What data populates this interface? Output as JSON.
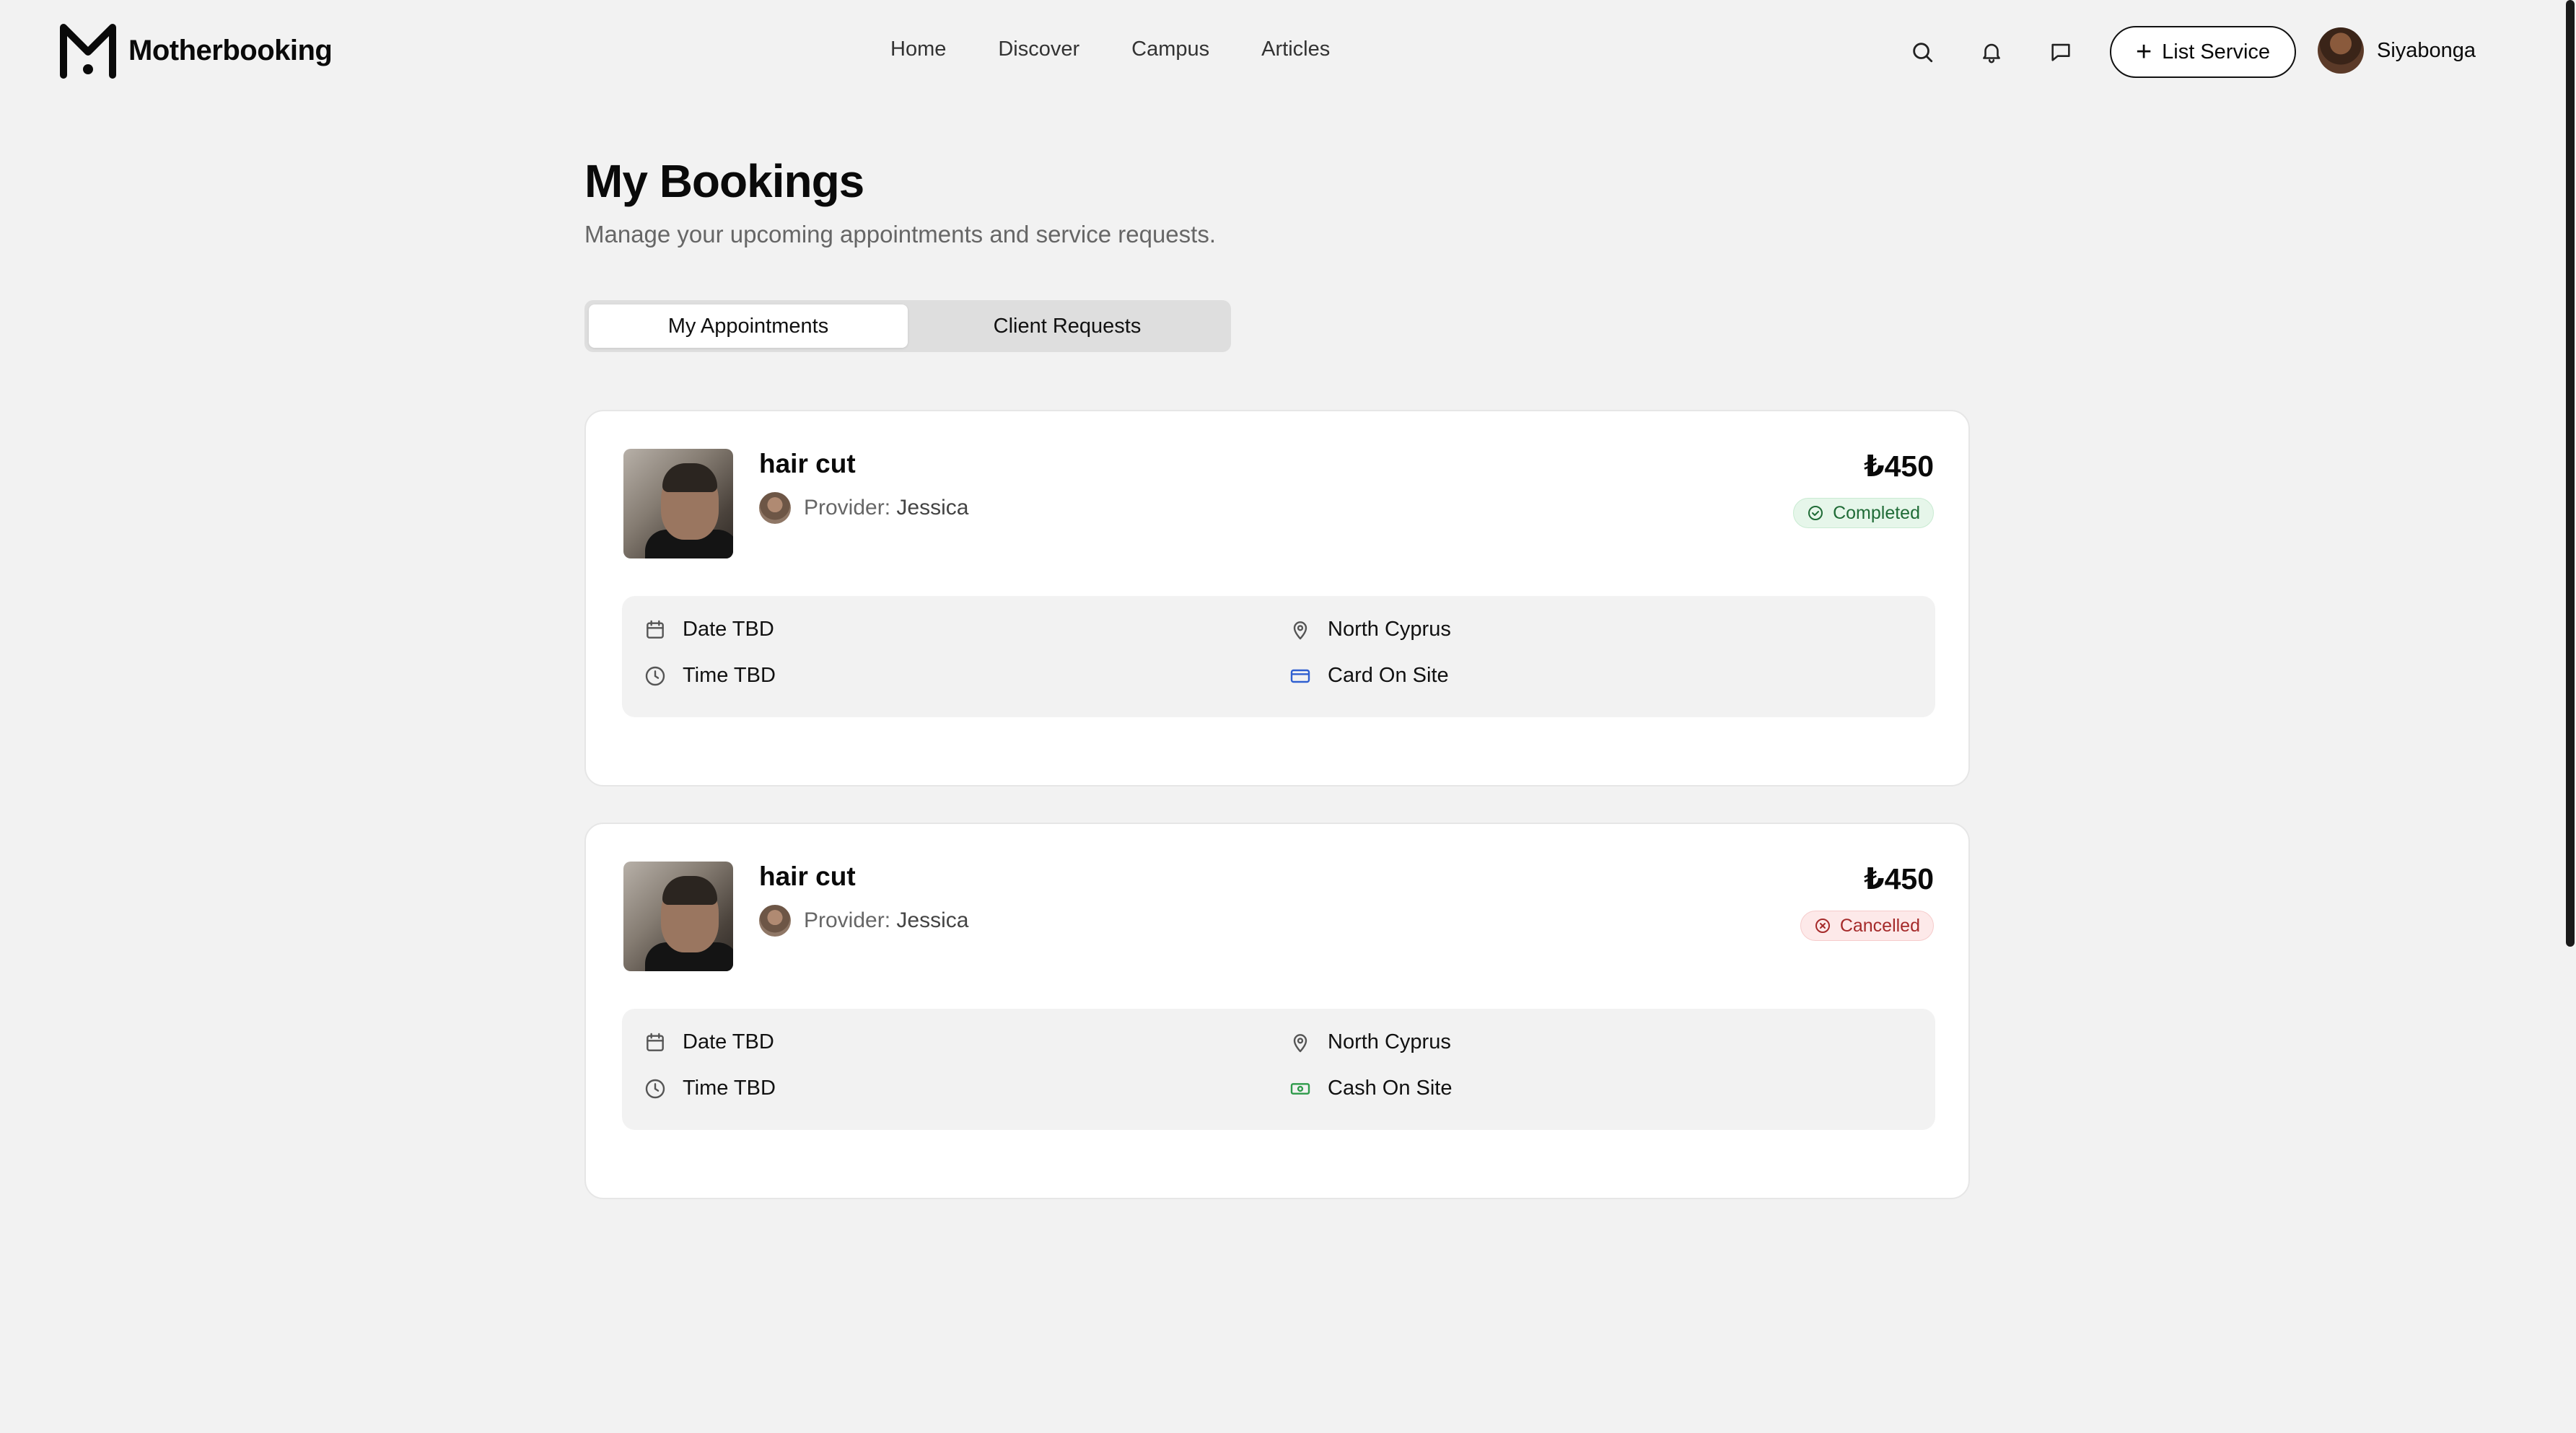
{
  "app": {
    "brand": "Motherbooking"
  },
  "nav": {
    "items": [
      "Home",
      "Discover",
      "Campus",
      "Articles"
    ]
  },
  "header": {
    "list_service_label": "List Service",
    "user_name": "Siyabonga"
  },
  "page": {
    "title": "My Bookings",
    "subtitle": "Manage your upcoming appointments and service requests."
  },
  "tabs": [
    {
      "label": "My Appointments",
      "active": true
    },
    {
      "label": "Client Requests",
      "active": false
    }
  ],
  "bookings": [
    {
      "service": "hair cut",
      "provider_prefix": "Provider:",
      "provider_name": "Jessica",
      "price": "₺450",
      "status": "Completed",
      "status_color": "#1f6b36",
      "date": "Date TBD",
      "time": "Time TBD",
      "location": "North Cyprus",
      "payment": "Card On Site",
      "payment_icon": "credit-card-icon",
      "payment_color": "#2f5fd0"
    },
    {
      "service": "hair cut",
      "provider_prefix": "Provider:",
      "provider_name": "Jessica",
      "price": "₺450",
      "status": "Cancelled",
      "status_color": "#a52a2a",
      "date": "Date TBD",
      "time": "Time TBD",
      "location": "North Cyprus",
      "payment": "Cash On Site",
      "payment_icon": "cash-icon",
      "payment_color": "#2e9a4a"
    }
  ]
}
